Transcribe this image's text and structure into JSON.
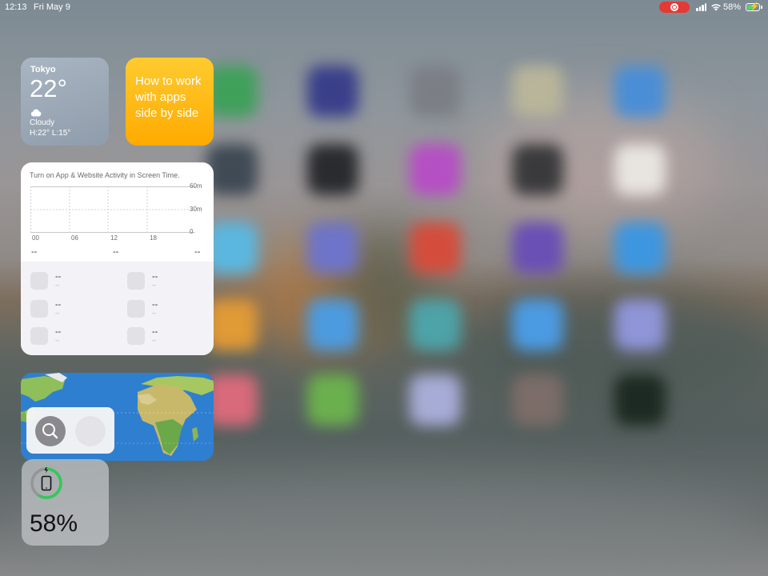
{
  "status_bar": {
    "time": "12:13",
    "date": "Fri May 9",
    "battery_percent": "58%",
    "battery_level": 0.58,
    "recording": true,
    "icons": [
      "screen-recording-icon",
      "cellular-signal-icon",
      "wifi-icon",
      "battery-charging-icon"
    ]
  },
  "weather_widget": {
    "city": "Tokyo",
    "temperature": "22°",
    "condition": "Cloudy",
    "high_low": "H:22° L:15°",
    "icon": "cloud-icon"
  },
  "tips_widget": {
    "text": "How to work with apps side by side",
    "color": "#ffb400"
  },
  "screen_time_widget": {
    "message": "Turn on App & Website Activity in Screen Time.",
    "y_labels": [
      "60m",
      "30m",
      "0"
    ],
    "x_labels": [
      "00",
      "06",
      "12",
      "18"
    ],
    "summary": [
      "--",
      "--",
      "--"
    ],
    "apps": [
      {
        "name": "--",
        "time": "--"
      },
      {
        "name": "--",
        "time": "--"
      },
      {
        "name": "--",
        "time": "--"
      },
      {
        "name": "--",
        "time": "--"
      },
      {
        "name": "--",
        "time": "--"
      },
      {
        "name": "--",
        "time": "--"
      }
    ]
  },
  "map_widget": {
    "buttons": [
      "search-icon",
      "placeholder-button"
    ]
  },
  "battery_widget": {
    "percent": "58%",
    "level": 0.58,
    "device_icon": "ipad-icon",
    "ring_color": "#34c759"
  }
}
